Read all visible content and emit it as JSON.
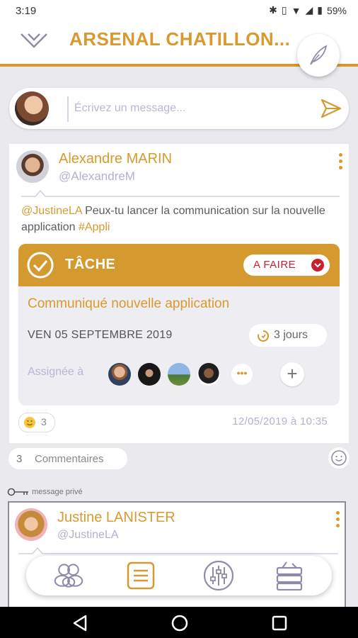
{
  "status_bar": {
    "time": "3:19",
    "battery": "59%"
  },
  "header": {
    "title": "ARSENAL CHATILLON...",
    "menu_icon": "chevron-down-icon",
    "compose_icon": "feather-icon"
  },
  "composer": {
    "placeholder": "Écrivez un message...",
    "send_icon": "send-icon"
  },
  "post": {
    "author": "Alexandre MARIN",
    "handle": "@AlexandreM",
    "mention": "@JustineLA",
    "text": " Peux-tu lancer la communication sur la nouvelle application ",
    "hashtag": "#Appli",
    "task": {
      "label": "TÂCHE",
      "status": "A FAIRE",
      "title": "Communiqué nouvelle application",
      "date": "VEN 05 SEPTEMBRE 2019",
      "duration": "3 jours",
      "assigned_label": "Assignée à",
      "more_label": "•••",
      "add_label": "+"
    },
    "reaction_count": "3",
    "timestamp": "12/05/2019 à 10:35"
  },
  "comments": {
    "count": "3",
    "label": "Commentaires"
  },
  "private_label": "message privé",
  "post2": {
    "author": "Justine LANISTER",
    "handle": "@JustineLA"
  },
  "colors": {
    "accent": "#d49a2f",
    "status_red": "#c8202f",
    "muted_lilac": "#b3b0d0"
  },
  "bottom_nav": [
    "groups-icon",
    "feed-icon",
    "settings-sliders-icon",
    "archive-icon"
  ]
}
